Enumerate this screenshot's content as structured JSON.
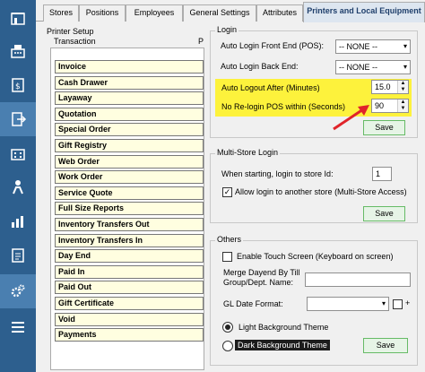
{
  "nav": {
    "items": [
      "store-icon",
      "register-icon",
      "invoice-icon",
      "exit-icon",
      "building-icon",
      "person-icon",
      "chart-icon",
      "report-icon",
      "gears-icon",
      "menu-icon"
    ],
    "rail_color": "#2d5f8e"
  },
  "tabs": [
    {
      "label": "Stores"
    },
    {
      "label": "Positions"
    },
    {
      "label": "Employees"
    },
    {
      "label": "General Settings"
    },
    {
      "label": "Attributes"
    },
    {
      "label": "Printers and Local Equipment"
    }
  ],
  "printer_setup": {
    "title": "Printer Setup",
    "column_header": "Transaction",
    "column_cut": "P",
    "rows": [
      "Invoice",
      "Cash Drawer",
      "Layaway",
      "Quotation",
      "Special Order",
      "Gift Registry",
      "Web Order",
      "Work Order",
      "Service Quote",
      "Full Size Reports",
      "Inventory Transfers Out",
      "Inventory Transfers In",
      "Day End",
      "Paid In",
      "Paid Out",
      "Gift Certificate",
      "Void",
      "Payments"
    ]
  },
  "login": {
    "title": "Login",
    "front_end_label": "Auto Login Front End (POS):",
    "front_end_value": "-- NONE --",
    "back_end_label": "Auto Login Back End:",
    "back_end_value": "-- NONE --",
    "logout_label": "Auto Logout After (Minutes)",
    "logout_value": "15.0",
    "relogin_label": "No Re-login POS within (Seconds)",
    "relogin_value": "90",
    "save_label": "Save",
    "highlight_color": "#fdf23c"
  },
  "multistore": {
    "title": "Multi-Store Login",
    "store_id_label": "When starting, login to store Id:",
    "store_id_value": "1",
    "allow_label": "Allow login to another store (Multi-Store Access)",
    "allow_checked": "✓",
    "save_label": "Save"
  },
  "others": {
    "title": "Others",
    "touch_label": "Enable Touch Screen (Keyboard on screen)",
    "merge_label_1": "Merge Dayend By Till",
    "merge_label_2": "Group/Dept. Name:",
    "gl_label": "GL Date Format:",
    "plus_label": "+",
    "light_theme_label": "Light Background Theme",
    "dark_theme_label": "Dark Background Theme",
    "save_label": "Save"
  }
}
